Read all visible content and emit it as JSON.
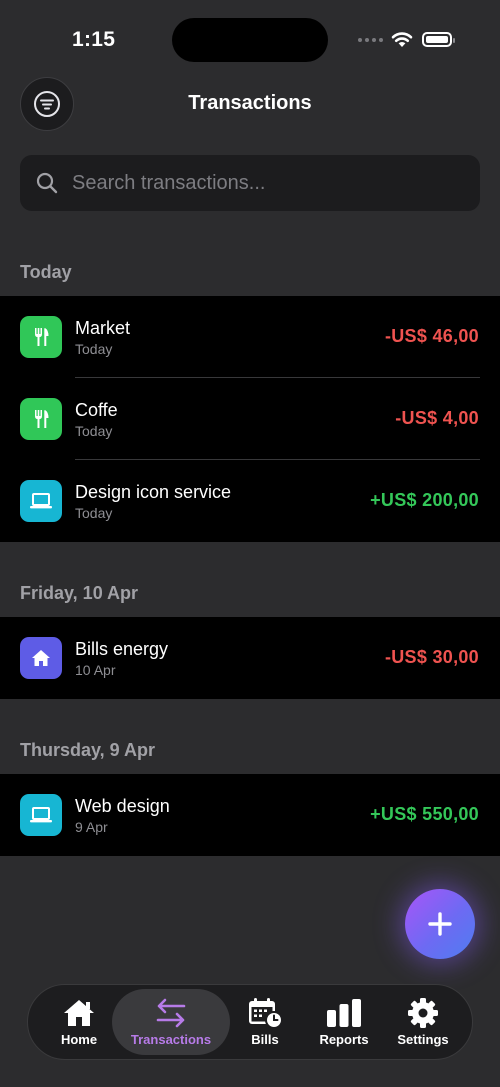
{
  "status": {
    "time": "1:15"
  },
  "header": {
    "title": "Transactions"
  },
  "search": {
    "placeholder": "Search transactions..."
  },
  "sections": [
    {
      "label": "Today",
      "items": [
        {
          "title": "Market",
          "subtitle": "Today",
          "amount": "-US$ 46,00",
          "icon": "fork-knife-icon",
          "icon_color": "#30c758",
          "amount_color": "#ef5350"
        },
        {
          "title": "Coffe",
          "subtitle": "Today",
          "amount": "-US$ 4,00",
          "icon": "fork-knife-icon",
          "icon_color": "#30c758",
          "amount_color": "#ef5350"
        },
        {
          "title": "Design icon service",
          "subtitle": "Today",
          "amount": "+US$ 200,00",
          "icon": "laptop-icon",
          "icon_color": "#17b6d3",
          "amount_color": "#34c759"
        }
      ]
    },
    {
      "label": "Friday, 10 Apr",
      "items": [
        {
          "title": "Bills energy",
          "subtitle": "10 Apr",
          "amount": "-US$ 30,00",
          "icon": "home-icon",
          "icon_color": "#5e5ce6",
          "amount_color": "#ef5350"
        }
      ]
    },
    {
      "label": "Thursday, 9 Apr",
      "items": [
        {
          "title": "Web design",
          "subtitle": "9 Apr",
          "amount": "+US$ 550,00",
          "icon": "laptop-icon",
          "icon_color": "#17b6d3",
          "amount_color": "#34c759"
        }
      ]
    }
  ],
  "tabbar": {
    "items": [
      {
        "label": "Home",
        "icon": "home-icon"
      },
      {
        "label": "Transactions",
        "icon": "transfer-arrows-icon",
        "active": true
      },
      {
        "label": "Bills",
        "icon": "calendar-clock-icon"
      },
      {
        "label": "Reports",
        "icon": "bar-chart-icon"
      },
      {
        "label": "Settings",
        "icon": "gear-icon"
      }
    ]
  },
  "colors": {
    "background": "#2c2c2e",
    "accent": "#b77be8",
    "income": "#34c759",
    "expense": "#ef5350"
  }
}
